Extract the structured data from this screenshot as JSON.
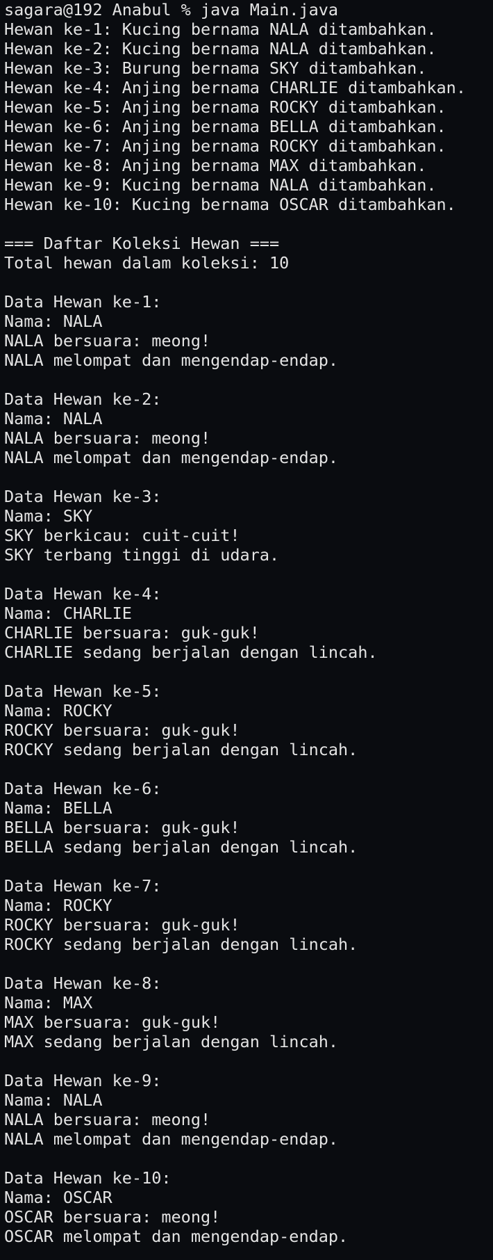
{
  "terminal": {
    "prompt": "sagara@192 Anabul % java Main.java",
    "added": [
      "Hewan ke-1: Kucing bernama NALA ditambahkan.",
      "Hewan ke-2: Kucing bernama NALA ditambahkan.",
      "Hewan ke-3: Burung bernama SKY ditambahkan.",
      "Hewan ke-4: Anjing bernama CHARLIE ditambahkan.",
      "Hewan ke-5: Anjing bernama ROCKY ditambahkan.",
      "Hewan ke-6: Anjing bernama BELLA ditambahkan.",
      "Hewan ke-7: Anjing bernama ROCKY ditambahkan.",
      "Hewan ke-8: Anjing bernama MAX ditambahkan.",
      "Hewan ke-9: Kucing bernama NALA ditambahkan.",
      "Hewan ke-10: Kucing bernama OSCAR ditambahkan."
    ],
    "collection_header": "=== Daftar Koleksi Hewan ===",
    "total": "Total hewan dalam koleksi: 10",
    "animals": [
      {
        "heading": "Data Hewan ke-1:",
        "name": "Nama: NALA",
        "sound": "NALA bersuara: meong!",
        "move": "NALA melompat dan mengendap-endap."
      },
      {
        "heading": "Data Hewan ke-2:",
        "name": "Nama: NALA",
        "sound": "NALA bersuara: meong!",
        "move": "NALA melompat dan mengendap-endap."
      },
      {
        "heading": "Data Hewan ke-3:",
        "name": "Nama: SKY",
        "sound": "SKY berkicau: cuit-cuit!",
        "move": "SKY terbang tinggi di udara."
      },
      {
        "heading": "Data Hewan ke-4:",
        "name": "Nama: CHARLIE",
        "sound": "CHARLIE bersuara: guk-guk!",
        "move": "CHARLIE sedang berjalan dengan lincah."
      },
      {
        "heading": "Data Hewan ke-5:",
        "name": "Nama: ROCKY",
        "sound": "ROCKY bersuara: guk-guk!",
        "move": "ROCKY sedang berjalan dengan lincah."
      },
      {
        "heading": "Data Hewan ke-6:",
        "name": "Nama: BELLA",
        "sound": "BELLA bersuara: guk-guk!",
        "move": "BELLA sedang berjalan dengan lincah."
      },
      {
        "heading": "Data Hewan ke-7:",
        "name": "Nama: ROCKY",
        "sound": "ROCKY bersuara: guk-guk!",
        "move": "ROCKY sedang berjalan dengan lincah."
      },
      {
        "heading": "Data Hewan ke-8:",
        "name": "Nama: MAX",
        "sound": "MAX bersuara: guk-guk!",
        "move": "MAX sedang berjalan dengan lincah."
      },
      {
        "heading": "Data Hewan ke-9:",
        "name": "Nama: NALA",
        "sound": "NALA bersuara: meong!",
        "move": "NALA melompat dan mengendap-endap."
      },
      {
        "heading": "Data Hewan ke-10:",
        "name": "Nama: OSCAR",
        "sound": "OSCAR bersuara: meong!",
        "move": "OSCAR melompat dan mengendap-endap."
      }
    ],
    "colors": {
      "background": "#0a0c10",
      "text": "#e4e4e4"
    }
  }
}
